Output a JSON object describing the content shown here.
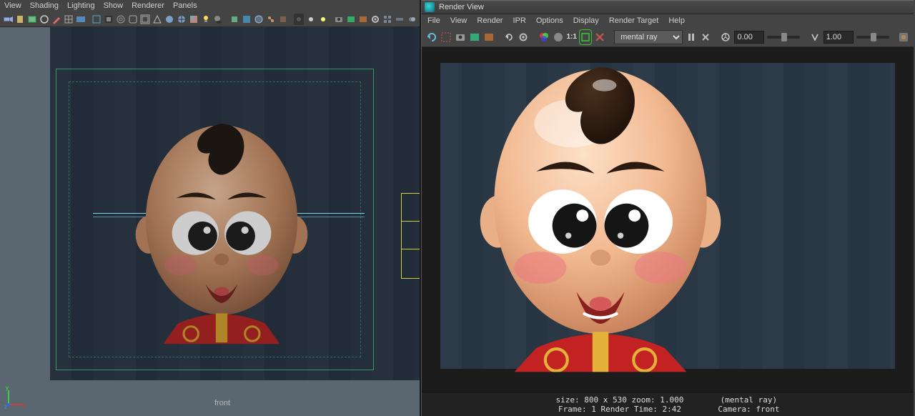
{
  "viewport": {
    "menu": [
      "View",
      "Shading",
      "Lighting",
      "Show",
      "Renderer",
      "Panels"
    ],
    "camera_label": "front"
  },
  "render_view": {
    "title": "Render View",
    "menu": [
      "File",
      "View",
      "Render",
      "IPR",
      "Options",
      "Display",
      "Render Target",
      "Help"
    ],
    "renderer_selected": "mental ray",
    "exposure": "0.00",
    "gamma": "1.00",
    "status": {
      "size": "size: 800 x 530  zoom: 1.000",
      "frame": "Frame: 1      Render Time: 2:42",
      "engine": "(mental ray)",
      "camera": "Camera: front"
    }
  }
}
